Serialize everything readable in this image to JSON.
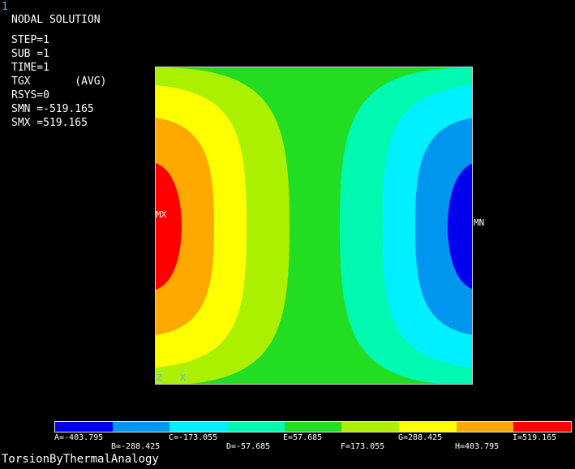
{
  "window": {
    "number": "1"
  },
  "plot": {
    "title": "NODAL SOLUTION",
    "info_lines": [
      "STEP=1",
      "SUB =1",
      "TIME=1",
      "TGX       (AVG)",
      "RSYS=0",
      "SMN =-519.165",
      "SMX =519.165"
    ],
    "max_marker": "MX",
    "min_marker": "MN",
    "triad": {
      "z_label": "Z",
      "x_label": "X"
    },
    "colors": {
      "background": "#000000",
      "frame": "#cfcfcf",
      "contour_bands": [
        "#0000ee",
        "#0096f0",
        "#00f0ff",
        "#00f8b0",
        "#22dd22",
        "#aaf000",
        "#ffff00",
        "#ffa800",
        "#ff0000"
      ]
    }
  },
  "legend": {
    "labels": [
      "A=-403.795",
      "B=-288.425",
      "C=-173.055",
      "D=-57.685",
      "E=57.685",
      "F=173.055",
      "G=288.425",
      "H=403.795",
      "I=519.165"
    ],
    "values": [
      -519.165,
      -403.795,
      -288.425,
      -173.055,
      -57.685,
      57.685,
      173.055,
      288.425,
      403.795,
      519.165
    ],
    "colors": [
      "#0000ee",
      "#0096f0",
      "#00f0ff",
      "#00f8b0",
      "#22dd22",
      "#aaf000",
      "#ffff00",
      "#ffa800",
      "#ff0000"
    ]
  },
  "footer": {
    "title": "TorsionByThermalAnalogy"
  }
}
